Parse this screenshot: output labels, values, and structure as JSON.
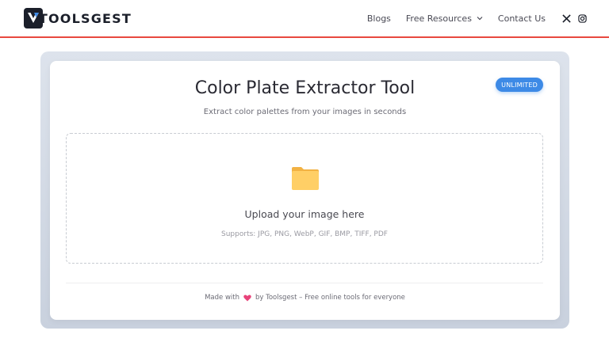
{
  "header": {
    "logo_text": "TOOLSGEST",
    "nav": [
      {
        "label": "Blogs"
      },
      {
        "label": "Free Resources"
      },
      {
        "label": "Contact Us"
      }
    ],
    "social_icons": [
      "x-icon",
      "instagram-icon"
    ]
  },
  "card": {
    "badge": "UNLIMITED",
    "title": "Color Plate Extractor Tool",
    "subtitle": "Extract color palettes from your images in seconds",
    "upload": {
      "icon": "folder-icon",
      "title": "Upload your image here",
      "formats": "Supports: JPG, PNG, WebP, GIF, BMP, TIFF, PDF"
    },
    "footer": {
      "prefix": "Made with",
      "suffix": "by Toolsgest – Free online tools for everyone"
    }
  },
  "colors": {
    "accent_red": "#e8483f",
    "badge_blue": "#3d8ae6",
    "folder_yellow": "#ffc95e",
    "heart_pink": "#e8437a"
  }
}
